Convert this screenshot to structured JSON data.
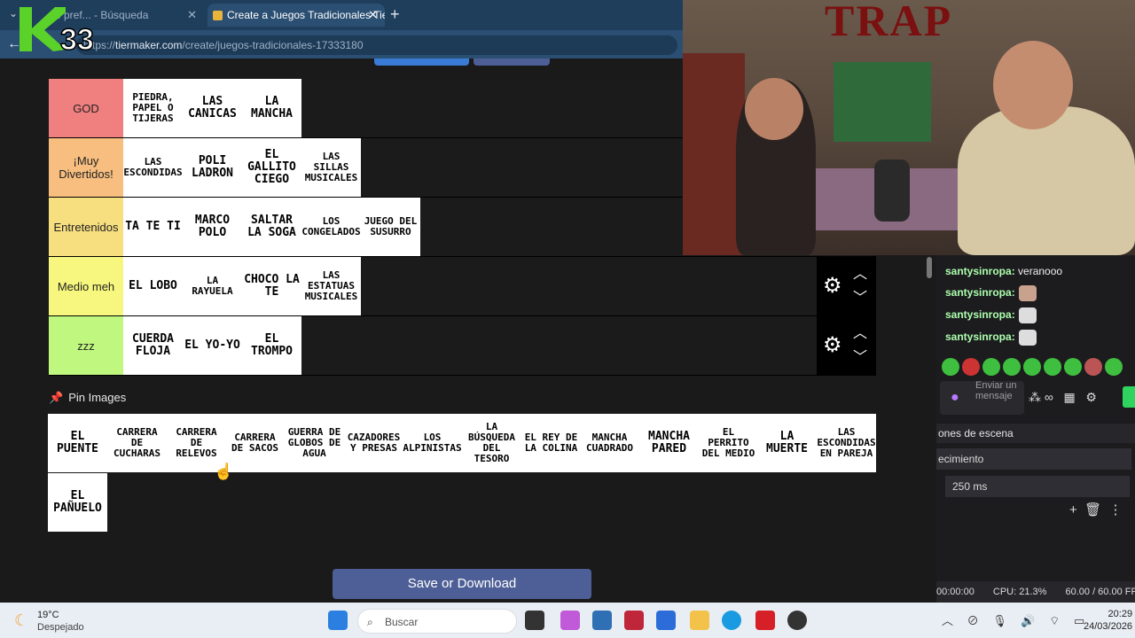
{
  "browser": {
    "tabs": [
      {
        "label": "e pref... - Búsqueda"
      },
      {
        "label": "Create a Juegos Tradicionales Tier"
      }
    ],
    "url_domain": "tiermaker.com",
    "url_path": "/create/juegos-tradicionales-17333180",
    "url_scheme": "https://"
  },
  "overlay_logo": "K33",
  "tiers": [
    {
      "label": "GOD",
      "color": "#f07f7f",
      "items": [
        "piedra, papel o tijeras",
        "las canicas",
        "la mancha"
      ]
    },
    {
      "label": "¡Muy Divertidos!",
      "color": "#f7be7f",
      "items": [
        "las escondidas",
        "poli ladron",
        "el gallito ciego",
        "las sillas musicales"
      ]
    },
    {
      "label": "Entretenidos",
      "color": "#f7de7f",
      "items": [
        "ta te ti",
        "marco polo",
        "saltar la soga",
        "los congelados",
        "juego del susurro"
      ]
    },
    {
      "label": "Medio meh",
      "color": "#f7f77f",
      "items": [
        "el lobo",
        "la rayuela",
        "choco la te",
        "las estatuas musicales"
      ]
    },
    {
      "label": "zzz",
      "color": "#bff77f",
      "items": [
        "cuerda floja",
        "el yo-yo",
        "el trompo"
      ]
    }
  ],
  "pin_images_label": "Pin Images",
  "pool_items": [
    "el puente",
    "carrera de cucharas",
    "carrera de relevos",
    "carrera de sacos",
    "guerra de globos de agua",
    "cazadores y presas",
    "los alpinistas",
    "la búsqueda del tesoro",
    "el rey de la colina",
    "mancha cuadrado",
    "mancha pared",
    "el perrito del medio",
    "la muerte",
    "las escondidas en pareja",
    "el pañuelo"
  ],
  "save_button": "Save or Download",
  "webcam": {
    "wall_text": "TRAP"
  },
  "chat": {
    "messages": [
      {
        "user": "santysinropa:",
        "text": "veranooo"
      },
      {
        "user": "santysinropa:",
        "text": ""
      },
      {
        "user": "santysinropa:",
        "text": ""
      },
      {
        "user": "santysinropa:",
        "text": ""
      }
    ],
    "send_placeholder": "Enviar un mensaje"
  },
  "obs": {
    "transitions_header": "ones de escena",
    "transition_select": "ecimiento",
    "duration": "250 ms",
    "status_time": "00:00:00",
    "cpu": "CPU: 21.3%",
    "fps": "60.00 / 60.00 FPS"
  },
  "taskbar": {
    "weather_temp": "19°C",
    "weather_desc": "Despejado",
    "search_placeholder": "Buscar",
    "time": "20:29",
    "date": "24/03/2026"
  }
}
